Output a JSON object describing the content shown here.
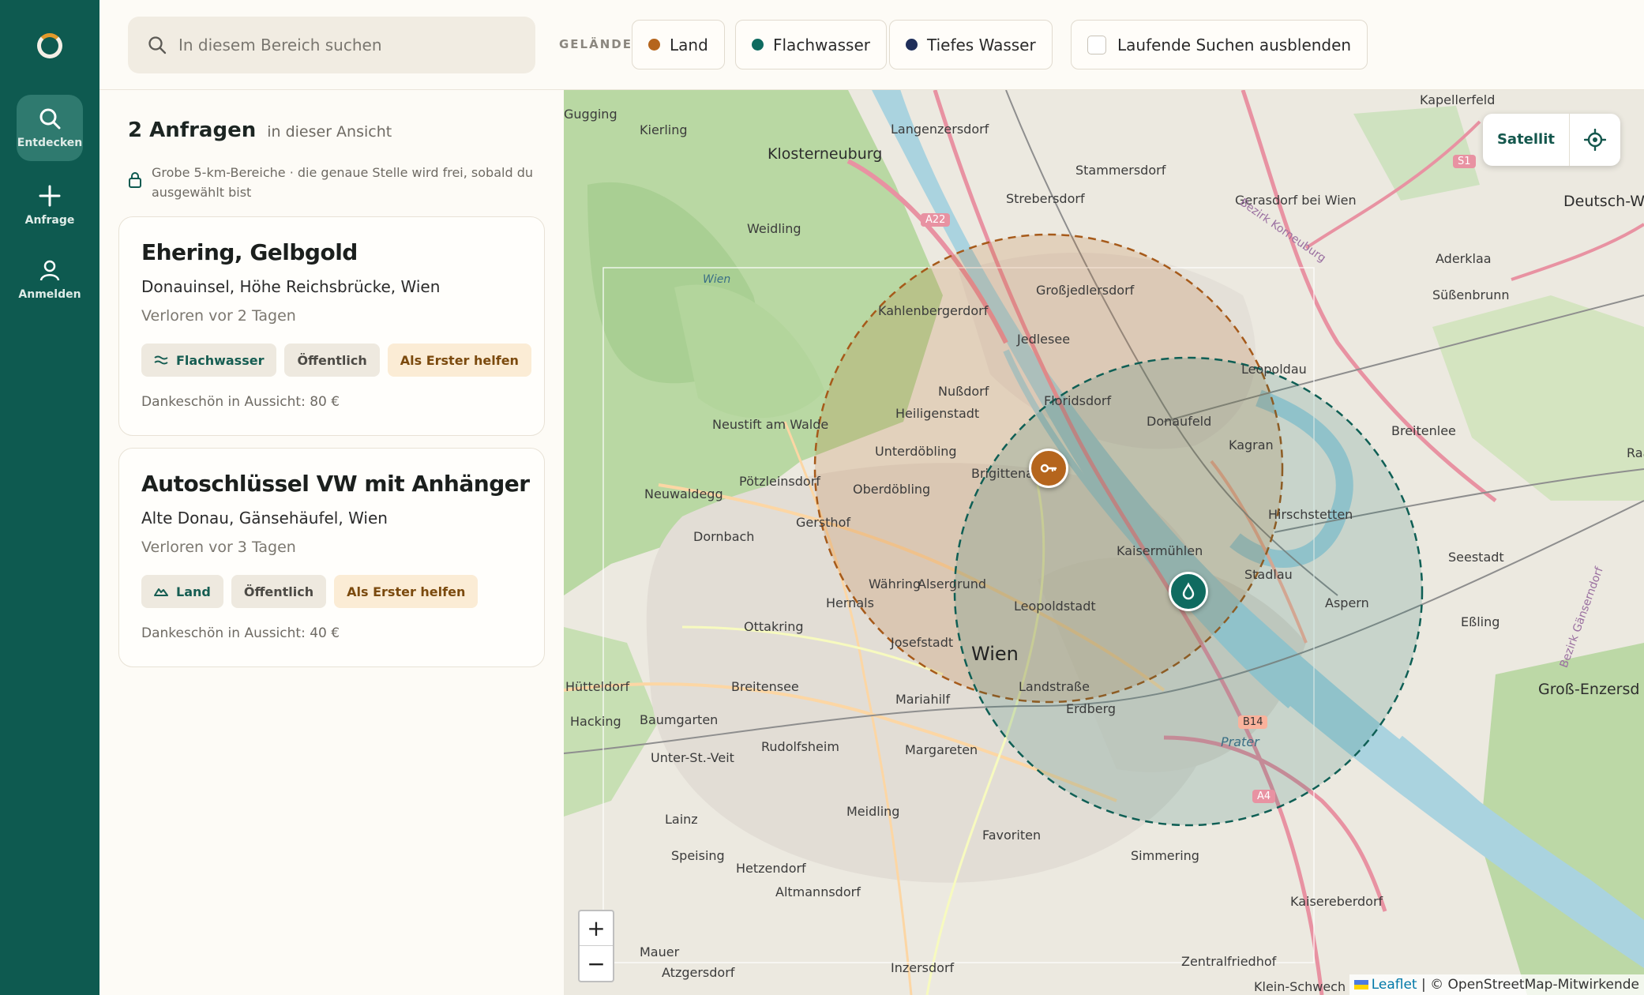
{
  "nav": {
    "items": [
      {
        "label": "Entdecken",
        "active": true
      },
      {
        "label": "Anfrage",
        "active": false
      },
      {
        "label": "Anmelden",
        "active": false
      }
    ]
  },
  "search": {
    "placeholder": "In diesem Bereich suchen"
  },
  "filters": {
    "label": "GELÄNDE",
    "terrain": [
      {
        "label": "Land",
        "color": "#b5651d"
      },
      {
        "label": "Flachwasser",
        "color": "#0f6b60"
      },
      {
        "label": "Tiefes Wasser",
        "color": "#1f2f5a"
      }
    ],
    "hide_running": {
      "label": "Laufende Suchen ausblenden",
      "checked": false
    }
  },
  "list": {
    "count": "2 Anfragen",
    "count_suffix": "in dieser Ansicht",
    "notice": "Grobe 5-km-Bereiche · die genaue Stelle wird frei, sobald du ausgewählt bist",
    "cards": [
      {
        "title": "Ehering, Gelbgold",
        "location": "Donauinsel, Höhe Reichsbrücke, Wien",
        "time": "Verloren vor 2 Tagen",
        "terrain": "Flachwasser",
        "visibility": "Öffentlich",
        "cta": "Als Erster helfen",
        "reward": "Dankeschön in Aussicht: 80 €"
      },
      {
        "title": "Autoschlüssel VW mit Anhänger",
        "location": "Alte Donau, Gänsehäufel, Wien",
        "time": "Verloren vor 3 Tagen",
        "terrain": "Land",
        "visibility": "Öffentlich",
        "cta": "Als Erster helfen",
        "reward": "Dankeschön in Aussicht: 40 €"
      }
    ]
  },
  "map": {
    "satellite_label": "Satellit",
    "zoom_in": "+",
    "zoom_out": "−",
    "attribution_leaflet": "Leaflet",
    "attribution_rest": "| © OpenStreetMap-Mitwirkende",
    "places": [
      "Gugging",
      "Kierling",
      "Klosterneuburg",
      "Langenzersdorf",
      "Kapellerfeld",
      "Stammersdorf",
      "Strebersdorf",
      "Gerasdorf bei Wien",
      "Deutsch-W",
      "Weidling",
      "Großjedlersdorf",
      "Aderklaa",
      "Kahlenbergerdorf",
      "Süßenbrunn",
      "Jedlesee",
      "Leopoldau",
      "Nußdorf",
      "Floridsdorf",
      "Neustift am Walde",
      "Heiligenstadt",
      "Donaufeld",
      "Breitenlee",
      "Unterdöbling",
      "Kagran",
      "Raa",
      "Brigittenau",
      "Neuwaldegg",
      "Pötzleinsdorf",
      "Oberdöbling",
      "Hirschstetten",
      "Gersthof",
      "Dornbach",
      "Kaisermühlen",
      "Seestadt",
      "Stadlau",
      "Währing",
      "Alsergrund",
      "Aspern",
      "Hernals",
      "Leopoldstadt",
      "Eßling",
      "Ottakring",
      "Josefstadt",
      "Wien",
      "Hütteldorf",
      "Breitensee",
      "Landstraße",
      "Mariahilf",
      "Groß-Enzersd",
      "Hacking",
      "Baumgarten",
      "Erdberg",
      "Unter-St.-Veit",
      "Rudolfsheim",
      "Margareten",
      "Lainz",
      "Meidling",
      "Favoriten",
      "Speising",
      "Hetzendorf",
      "Simmering",
      "Altmannsdorf",
      "Kaisereberdorf",
      "Mauer",
      "Atzgersdorf",
      "Inzersdorf",
      "Zentralfriedhof",
      "Klein-Schwech",
      "Prater",
      "Wien",
      "Bezirk Korneuburg",
      "Bezirk Gänserndorf"
    ],
    "road_shields": [
      "A22",
      "S1",
      "B14",
      "A4"
    ]
  }
}
